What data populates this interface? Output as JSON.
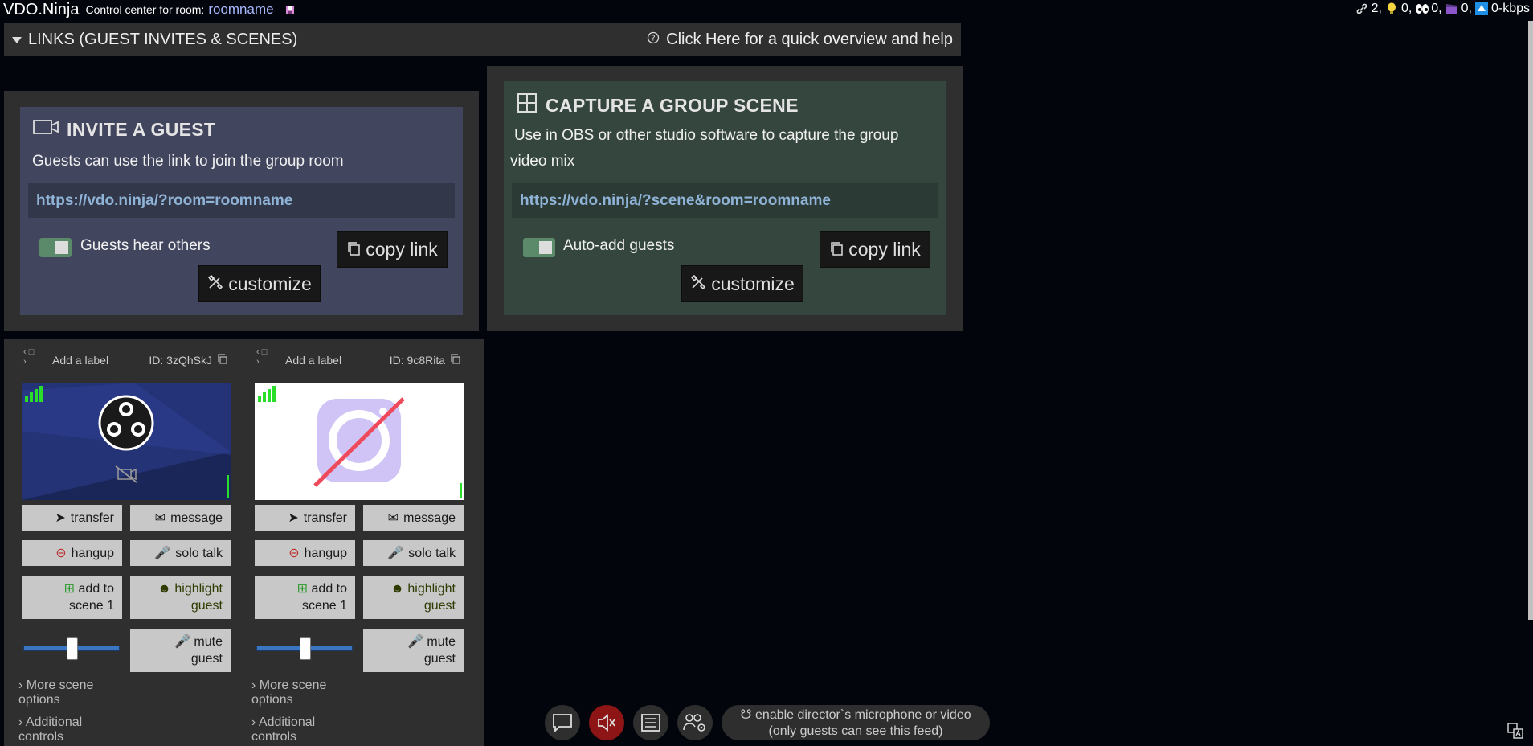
{
  "topbar": {
    "brand": "VDO.Ninja",
    "control_label": "Control center for room:",
    "room_name": "roomname",
    "stats": {
      "links": "2,",
      "bulbs": "0,",
      "viewers": "0,",
      "scenes": "0,",
      "upload": "0-kbps"
    }
  },
  "links_header": {
    "title": "LINKS (GUEST INVITES & SCENES)",
    "help": "Click Here for a quick overview and help"
  },
  "invite": {
    "title": "INVITE A GUEST",
    "description": "Guests can use the link to join the group room",
    "link": "https://vdo.ninja/?room=roomname",
    "toggle_label": "Guests hear others",
    "copy_label": "copy link",
    "customize_label": "customize"
  },
  "scene": {
    "title": "CAPTURE A GROUP SCENE",
    "description_line1": "Use in OBS or other studio software to capture the group",
    "description_line2": "video mix",
    "link": "https://vdo.ninja/?scene&room=roomname",
    "toggle_label": "Auto-add guests",
    "copy_label": "copy link",
    "customize_label": "customize"
  },
  "guests": [
    {
      "label_placeholder": "Add a label",
      "id": "ID: 3zQhSkJ",
      "buttons": {
        "transfer": "transfer",
        "message": "message",
        "hangup": "hangup",
        "solo_talk": "solo talk",
        "add_scene_1": "add to",
        "add_scene_2": "scene 1",
        "highlight_1": "highlight",
        "highlight_2": "guest",
        "mute_1": "mute",
        "mute_2": "guest"
      },
      "volume": 0.5,
      "more_scene": "More scene",
      "more_scene_2": "options",
      "additional": "Additional",
      "additional_2": "controls"
    },
    {
      "label_placeholder": "Add a label",
      "id": "ID: 9c8Rita",
      "buttons": {
        "transfer": "transfer",
        "message": "message",
        "hangup": "hangup",
        "solo_talk": "solo talk",
        "add_scene_1": "add to",
        "add_scene_2": "scene 1",
        "highlight_1": "highlight",
        "highlight_2": "guest",
        "mute_1": "mute",
        "mute_2": "guest"
      },
      "volume": 0.5,
      "more_scene": "More scene",
      "more_scene_2": "options",
      "additional": "Additional",
      "additional_2": "controls"
    }
  ],
  "director": {
    "line1": "enable director`s microphone or video",
    "line2": "(only guests can see this feed)"
  },
  "colors": {
    "background": "#02050b",
    "invite_card": "#42455e",
    "scene_card": "#35463f",
    "link_text": "#8fb3d6",
    "signal": "#2adf2a",
    "mute_red": "#8d1515"
  }
}
